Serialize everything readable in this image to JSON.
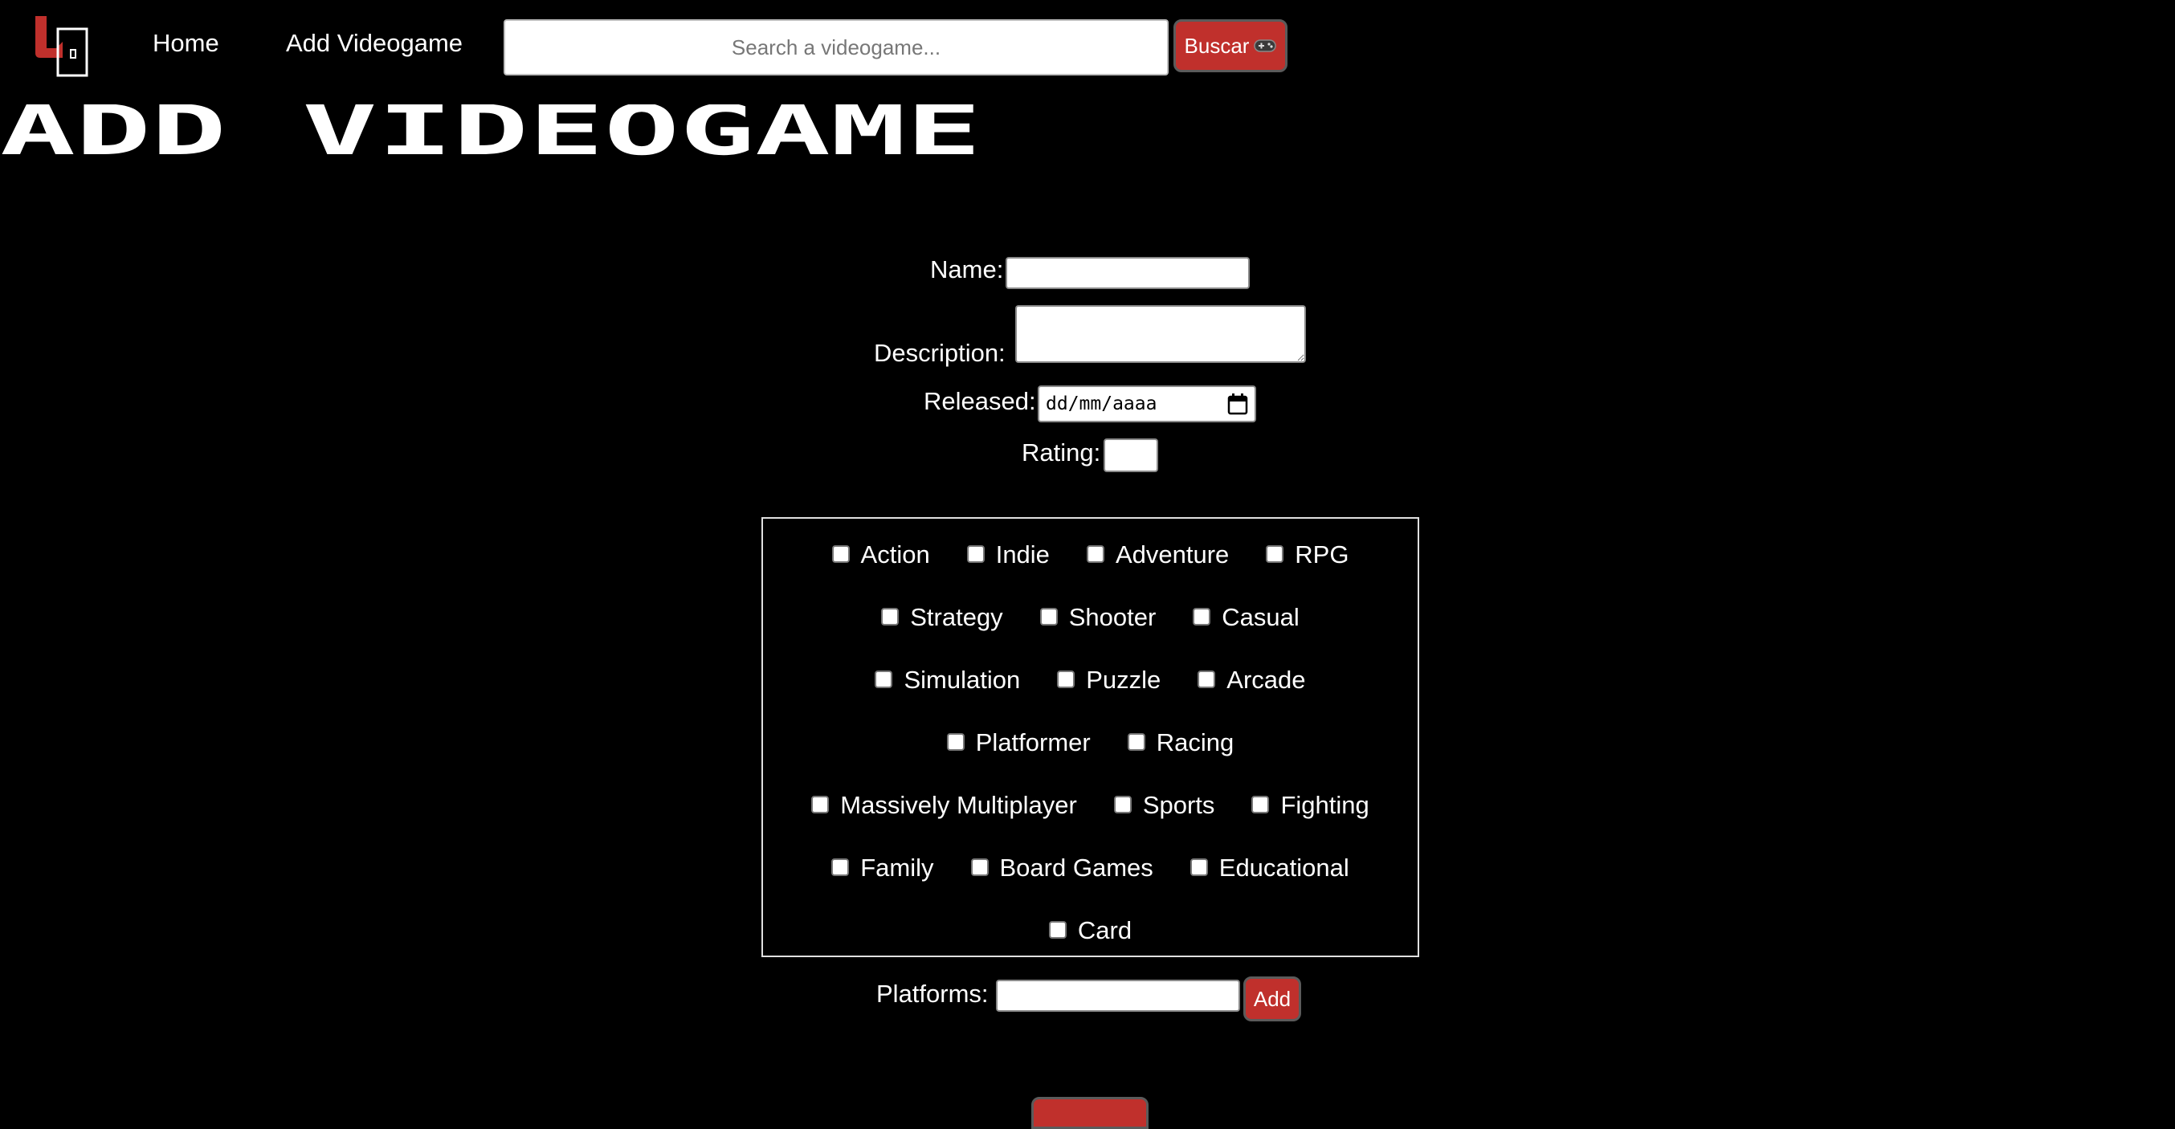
{
  "nav": {
    "home_label": "Home",
    "add_label": "Add Videogame"
  },
  "search": {
    "placeholder": "Search a videogame...",
    "button_label": "Buscar",
    "button_icon": "gamepad-icon"
  },
  "page": {
    "title": "ADD VIDEOGAME"
  },
  "form": {
    "name_label": "Name:",
    "name_value": "",
    "description_label": "Description:",
    "description_value": "",
    "released_label": "Released:",
    "released_placeholder": "dd/mm/aaaa",
    "rating_label": "Rating:",
    "rating_value": "",
    "platforms_label": "Platforms:",
    "platforms_value": "",
    "add_button_label": "Add"
  },
  "genres": [
    [
      "Action",
      "Indie",
      "Adventure",
      "RPG"
    ],
    [
      "Strategy",
      "Shooter",
      "Casual"
    ],
    [
      "Simulation",
      "Puzzle",
      "Arcade"
    ],
    [
      "Platformer",
      "Racing"
    ],
    [
      "Massively Multiplayer",
      "Sports",
      "Fighting"
    ],
    [
      "Family",
      "Board Games",
      "Educational"
    ],
    [
      "Card"
    ]
  ],
  "colors": {
    "background": "#000000",
    "accent": "#c0302c",
    "text": "#ffffff"
  }
}
